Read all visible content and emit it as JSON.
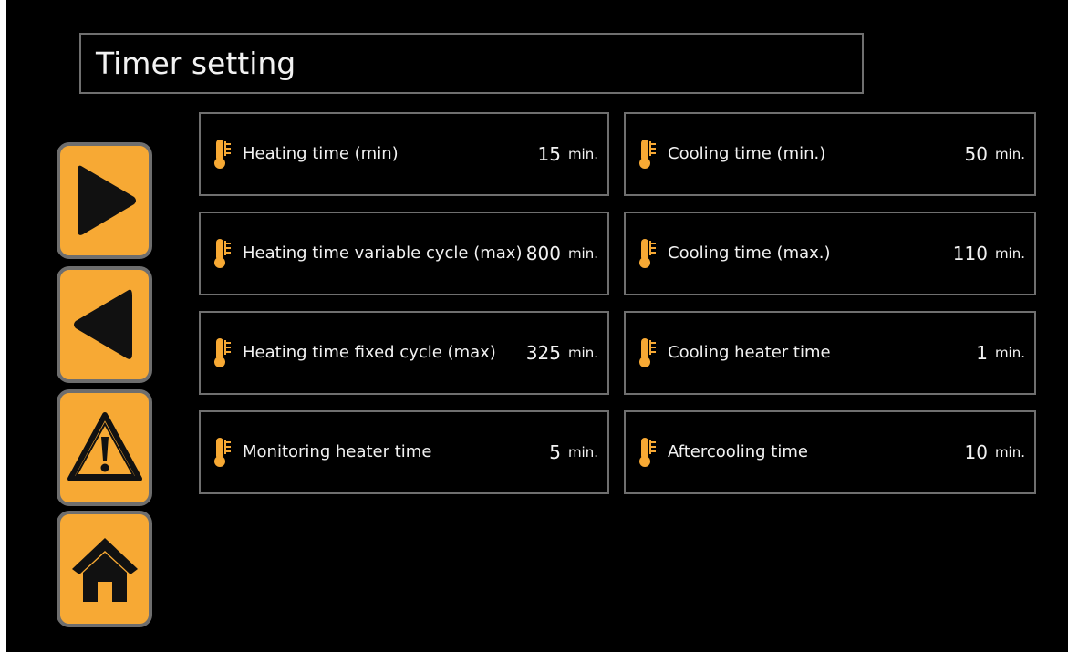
{
  "screen": {
    "title": "Timer setting"
  },
  "nav": {
    "buttons": [
      {
        "icon": "play-right-icon",
        "color": "#f7a934"
      },
      {
        "icon": "play-left-icon",
        "color": "#f7a934"
      },
      {
        "icon": "warning-icon",
        "color": "#f7a934"
      },
      {
        "icon": "home-icon",
        "color": "#f7a934"
      }
    ]
  },
  "parameters": {
    "left": [
      {
        "label": "Heating time (min)",
        "value": "15",
        "unit": "min."
      },
      {
        "label": "Heating time variable cycle (max)",
        "value": "800",
        "unit": "min."
      },
      {
        "label": "Heating time fixed cycle (max)",
        "value": "325",
        "unit": "min."
      },
      {
        "label": "Monitoring heater time",
        "value": "5",
        "unit": "min."
      }
    ],
    "right": [
      {
        "label": "Cooling time (min.)",
        "value": "50",
        "unit": "min."
      },
      {
        "label": "Cooling time (max.)",
        "value": "110",
        "unit": "min."
      },
      {
        "label": "Cooling heater time",
        "value": "1",
        "unit": "min."
      },
      {
        "label": "Aftercooling time",
        "value": "10",
        "unit": "min."
      }
    ],
    "icon": "thermometer-icon",
    "icon_color": "#f7a934",
    "border_color": "#6f6f6f"
  }
}
